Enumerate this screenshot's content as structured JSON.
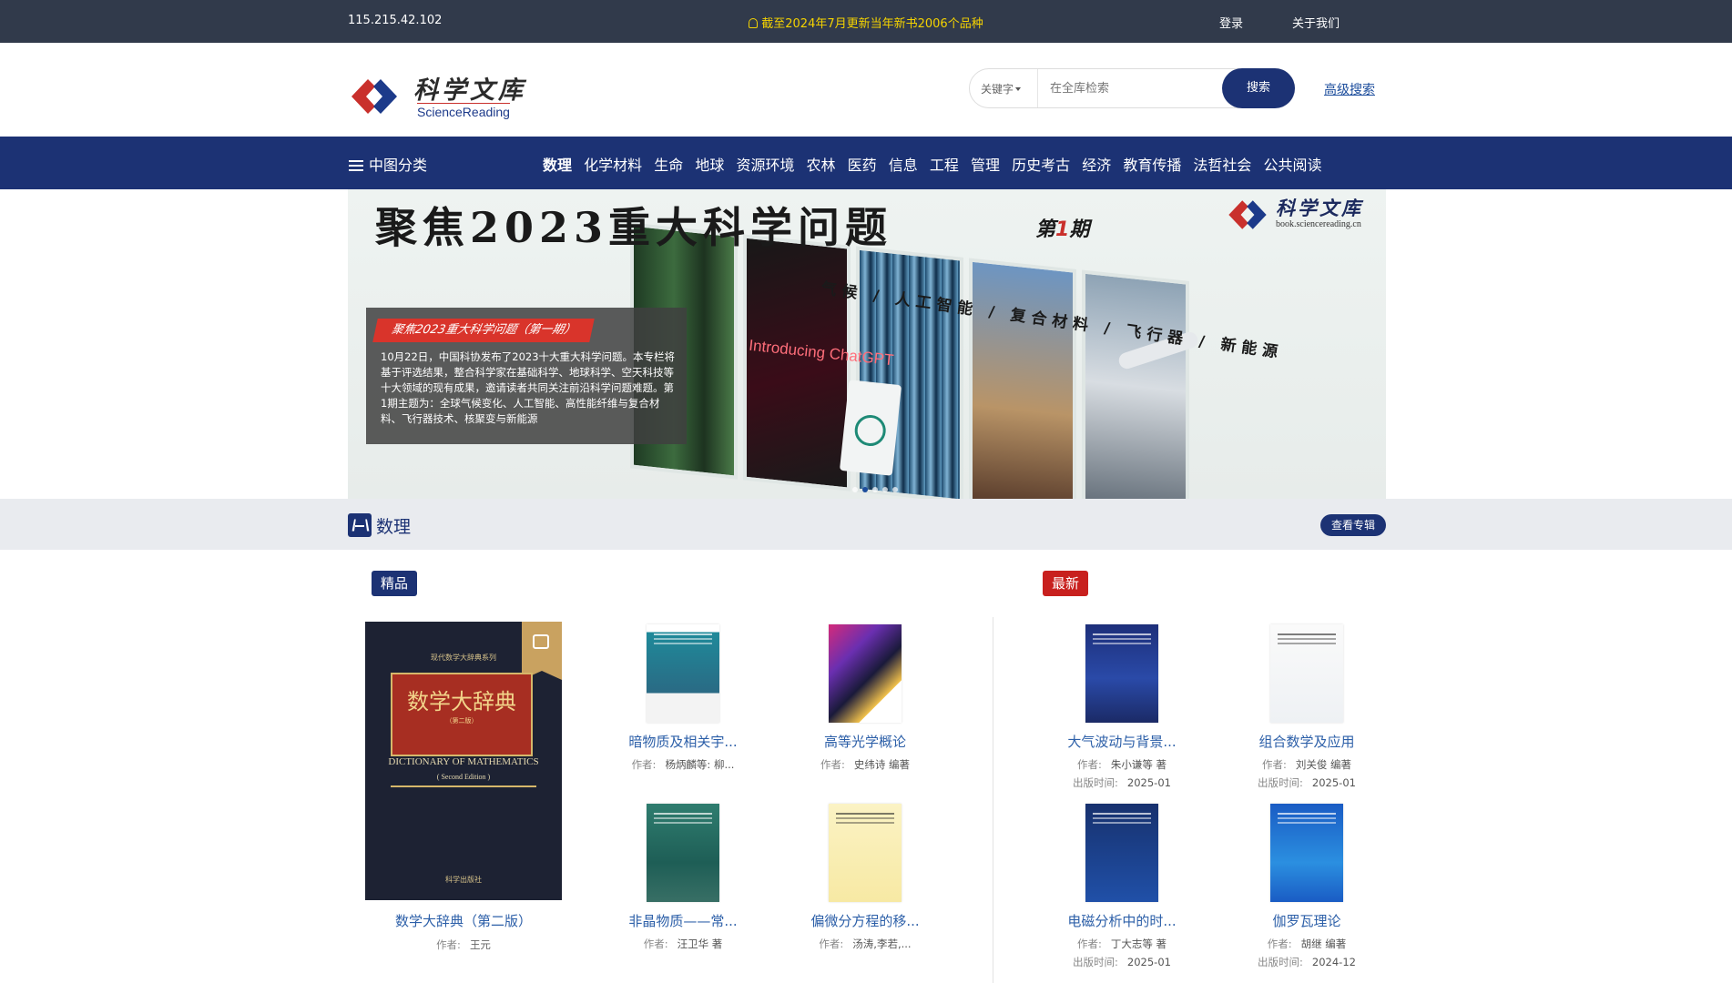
{
  "topbar": {
    "ip": "115.215.42.102",
    "notice": "截至2024年7月更新当年新书2006个品种",
    "login": "登录",
    "about": "关于我们"
  },
  "header": {
    "logo_cn": "科学文库",
    "logo_en": "ScienceReading",
    "search_select": "关键字",
    "search_placeholder": "在全库检索",
    "search_button": "搜索",
    "advanced_search": "高级搜索"
  },
  "nav": {
    "category_label": "中图分类",
    "items": [
      "数理",
      "化学材料",
      "生命",
      "地球",
      "资源环境",
      "农林",
      "医药",
      "信息",
      "工程",
      "管理",
      "历史考古",
      "经济",
      "教育传播",
      "法哲社会",
      "公共阅读"
    ],
    "active": "数理"
  },
  "banner": {
    "title": "聚焦2023重大科学问题",
    "issue_prefix": "第",
    "issue_num": "1",
    "issue_suffix": "期",
    "logo_cn": "科学文库",
    "logo_url": "book.sciencereading.cn",
    "topics": "气候 / 人工智能 / 复合材料 / 飞行器 / 新能源",
    "image_text": "Introducing ChatGPT",
    "caption_tag": "聚焦2023重大科学问题（第一期）",
    "caption_text": "10月22日，中国科协发布了2023十大重大科学问题。本专栏将基于评选结果，整合科学家在基础科学、地球科学、空天科技等十大领域的现有成果，邀请读者共同关注前沿科学问题难题。第1期主题为：全球气候变化、人工智能、高性能纤维与复合材料、飞行器技术、核聚变与新能源"
  },
  "section": {
    "title": "数理",
    "more_button": "查看专辑",
    "featured_label": "精品",
    "latest_label": "最新"
  },
  "featured": {
    "title": "数学大辞典（第二版）",
    "author_label": "作者:",
    "author": "王元",
    "cover_series": "现代数学大辞典系列",
    "cover_title": "数学大辞典",
    "cover_edition": "（第二版）",
    "cover_en": "DICTIONARY OF MATHEMATICS",
    "cover_en_edition": "( Second Edition )",
    "cover_publisher": "科学出版社"
  },
  "books_featured": [
    {
      "title": "暗物质及相关宇...",
      "author_label": "作者:",
      "author": "杨炳麟等: 柳..."
    },
    {
      "title": "高等光学概论",
      "author_label": "作者:",
      "author": "史纬诗 编著"
    },
    {
      "title": "非晶物质——常...",
      "author_label": "作者:",
      "author": "汪卫华 著"
    },
    {
      "title": "偏微分方程的移...",
      "author_label": "作者:",
      "author": "汤涛,李若,..."
    }
  ],
  "books_latest": [
    {
      "title": "大气波动与背景...",
      "author_label": "作者:",
      "author": "朱小谦等 著",
      "date_label": "出版时间:",
      "date": "2025-01"
    },
    {
      "title": "组合数学及应用",
      "author_label": "作者:",
      "author": "刘关俊 编著",
      "date_label": "出版时间:",
      "date": "2025-01"
    },
    {
      "title": "电磁分析中的时...",
      "author_label": "作者:",
      "author": "丁大志等 著",
      "date_label": "出版时间:",
      "date": "2025-01"
    },
    {
      "title": "伽罗瓦理论",
      "author_label": "作者:",
      "author": "胡继 编著",
      "date_label": "出版时间:",
      "date": "2024-12"
    }
  ],
  "colors": {
    "topbar": "#313a4b",
    "brand_navy": "#1c3274",
    "notice_yellow": "#f5d300",
    "latest_red": "#c8201e",
    "link_blue": "#2c5fa8"
  }
}
